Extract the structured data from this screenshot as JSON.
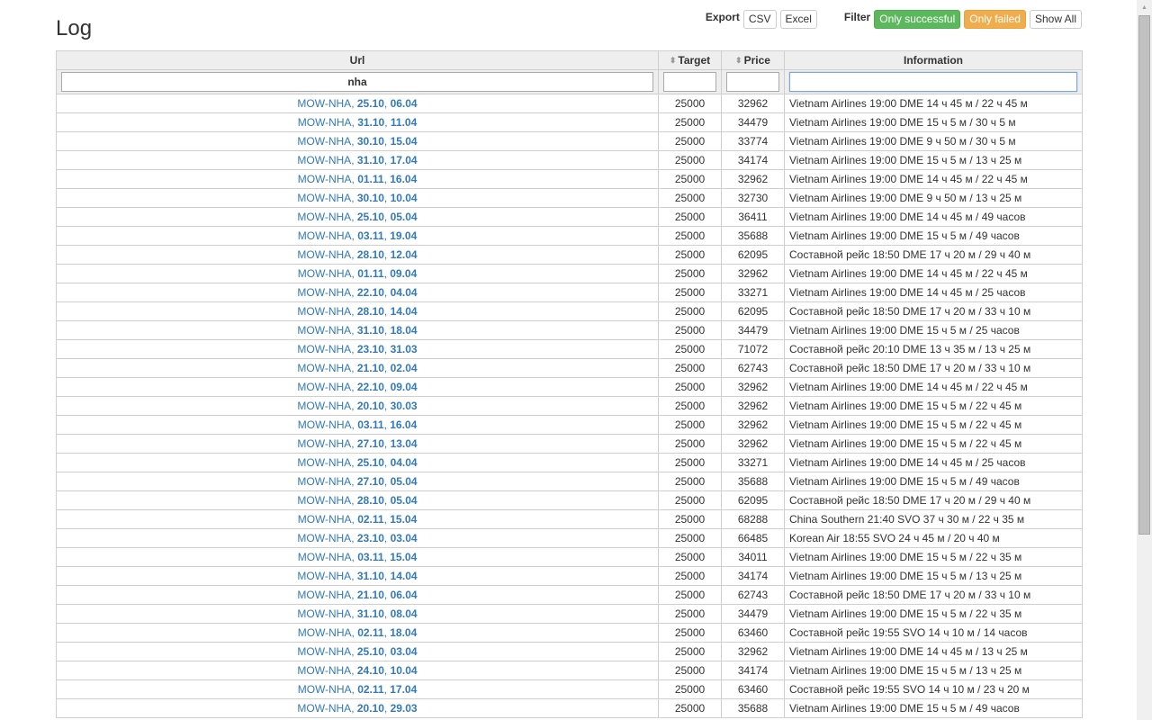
{
  "page": {
    "title": "Log"
  },
  "toolbar": {
    "export_label": "Export",
    "csv_label": "CSV",
    "excel_label": "Excel",
    "filter_label": "Filter",
    "only_successful_label": "Only successful",
    "only_failed_label": "Only failed",
    "show_all_label": "Show All",
    "colors": {
      "success": "#5cb85c",
      "warning": "#f0ad4e"
    }
  },
  "table": {
    "columns": [
      {
        "label": "Url",
        "sortable": false,
        "filter_value": "nha"
      },
      {
        "label": "Target",
        "sortable": true,
        "filter_value": ""
      },
      {
        "label": "Price",
        "sortable": true,
        "filter_value": ""
      },
      {
        "label": "Information",
        "sortable": false,
        "filter_value": ""
      }
    ],
    "sort_icon": "sort-both-icon",
    "link_color": "#337ab7",
    "rows": [
      {
        "route": "MOW-NHA",
        "d1": "25.10",
        "d2": "06.04",
        "target": "25000",
        "price": "32962",
        "info": "Vietnam Airlines 19:00 DME 14 ч 45 м / 22 ч 45 м"
      },
      {
        "route": "MOW-NHA",
        "d1": "31.10",
        "d2": "11.04",
        "target": "25000",
        "price": "34479",
        "info": "Vietnam Airlines 19:00 DME 15 ч 5 м / 30 ч 5 м"
      },
      {
        "route": "MOW-NHA",
        "d1": "30.10",
        "d2": "15.04",
        "target": "25000",
        "price": "33774",
        "info": "Vietnam Airlines 19:00 DME 9 ч 50 м / 30 ч 5 м"
      },
      {
        "route": "MOW-NHA",
        "d1": "31.10",
        "d2": "17.04",
        "target": "25000",
        "price": "34174",
        "info": "Vietnam Airlines 19:00 DME 15 ч 5 м / 13 ч 25 м"
      },
      {
        "route": "MOW-NHA",
        "d1": "01.11",
        "d2": "16.04",
        "target": "25000",
        "price": "32962",
        "info": "Vietnam Airlines 19:00 DME 14 ч 45 м / 22 ч 45 м"
      },
      {
        "route": "MOW-NHA",
        "d1": "30.10",
        "d2": "10.04",
        "target": "25000",
        "price": "32730",
        "info": "Vietnam Airlines 19:00 DME 9 ч 50 м / 13 ч 25 м"
      },
      {
        "route": "MOW-NHA",
        "d1": "25.10",
        "d2": "05.04",
        "target": "25000",
        "price": "36411",
        "info": "Vietnam Airlines 19:00 DME 14 ч 45 м / 49 часов"
      },
      {
        "route": "MOW-NHA",
        "d1": "03.11",
        "d2": "19.04",
        "target": "25000",
        "price": "35688",
        "info": "Vietnam Airlines 19:00 DME 15 ч 5 м / 49 часов"
      },
      {
        "route": "MOW-NHA",
        "d1": "28.10",
        "d2": "12.04",
        "target": "25000",
        "price": "62095",
        "info": "Составной рейс 18:50 DME 17 ч 20 м / 29 ч 40 м"
      },
      {
        "route": "MOW-NHA",
        "d1": "01.11",
        "d2": "09.04",
        "target": "25000",
        "price": "32962",
        "info": "Vietnam Airlines 19:00 DME 14 ч 45 м / 22 ч 45 м"
      },
      {
        "route": "MOW-NHA",
        "d1": "22.10",
        "d2": "04.04",
        "target": "25000",
        "price": "33271",
        "info": "Vietnam Airlines 19:00 DME 14 ч 45 м / 25 часов"
      },
      {
        "route": "MOW-NHA",
        "d1": "28.10",
        "d2": "14.04",
        "target": "25000",
        "price": "62095",
        "info": "Составной рейс 18:50 DME 17 ч 20 м / 33 ч 10 м"
      },
      {
        "route": "MOW-NHA",
        "d1": "31.10",
        "d2": "18.04",
        "target": "25000",
        "price": "34479",
        "info": "Vietnam Airlines 19:00 DME 15 ч 5 м / 25 часов"
      },
      {
        "route": "MOW-NHA",
        "d1": "23.10",
        "d2": "31.03",
        "target": "25000",
        "price": "71072",
        "info": "Составной рейс 20:10 DME 13 ч 35 м / 13 ч 25 м"
      },
      {
        "route": "MOW-NHA",
        "d1": "21.10",
        "d2": "02.04",
        "target": "25000",
        "price": "62743",
        "info": "Составной рейс 18:50 DME 17 ч 20 м / 33 ч 10 м"
      },
      {
        "route": "MOW-NHA",
        "d1": "22.10",
        "d2": "09.04",
        "target": "25000",
        "price": "32962",
        "info": "Vietnam Airlines 19:00 DME 14 ч 45 м / 22 ч 45 м"
      },
      {
        "route": "MOW-NHA",
        "d1": "20.10",
        "d2": "30.03",
        "target": "25000",
        "price": "32962",
        "info": "Vietnam Airlines 19:00 DME 15 ч 5 м / 22 ч 45 м"
      },
      {
        "route": "MOW-NHA",
        "d1": "03.11",
        "d2": "16.04",
        "target": "25000",
        "price": "32962",
        "info": "Vietnam Airlines 19:00 DME 15 ч 5 м / 22 ч 45 м"
      },
      {
        "route": "MOW-NHA",
        "d1": "27.10",
        "d2": "13.04",
        "target": "25000",
        "price": "32962",
        "info": "Vietnam Airlines 19:00 DME 15 ч 5 м / 22 ч 45 м"
      },
      {
        "route": "MOW-NHA",
        "d1": "25.10",
        "d2": "04.04",
        "target": "25000",
        "price": "33271",
        "info": "Vietnam Airlines 19:00 DME 14 ч 45 м / 25 часов"
      },
      {
        "route": "MOW-NHA",
        "d1": "27.10",
        "d2": "05.04",
        "target": "25000",
        "price": "35688",
        "info": "Vietnam Airlines 19:00 DME 15 ч 5 м / 49 часов"
      },
      {
        "route": "MOW-NHA",
        "d1": "28.10",
        "d2": "05.04",
        "target": "25000",
        "price": "62095",
        "info": "Составной рейс 18:50 DME 17 ч 20 м / 29 ч 40 м"
      },
      {
        "route": "MOW-NHA",
        "d1": "02.11",
        "d2": "15.04",
        "target": "25000",
        "price": "68288",
        "info": "China Southern 21:40 SVO 37 ч 30 м / 22 ч 35 м"
      },
      {
        "route": "MOW-NHA",
        "d1": "23.10",
        "d2": "03.04",
        "target": "25000",
        "price": "66485",
        "info": "Korean Air 18:55 SVO 24 ч 45 м / 20 ч 40 м"
      },
      {
        "route": "MOW-NHA",
        "d1": "03.11",
        "d2": "15.04",
        "target": "25000",
        "price": "34011",
        "info": "Vietnam Airlines 19:00 DME 15 ч 5 м / 22 ч 35 м"
      },
      {
        "route": "MOW-NHA",
        "d1": "31.10",
        "d2": "14.04",
        "target": "25000",
        "price": "34174",
        "info": "Vietnam Airlines 19:00 DME 15 ч 5 м / 13 ч 25 м"
      },
      {
        "route": "MOW-NHA",
        "d1": "21.10",
        "d2": "06.04",
        "target": "25000",
        "price": "62743",
        "info": "Составной рейс 18:50 DME 17 ч 20 м / 33 ч 10 м"
      },
      {
        "route": "MOW-NHA",
        "d1": "31.10",
        "d2": "08.04",
        "target": "25000",
        "price": "34479",
        "info": "Vietnam Airlines 19:00 DME 15 ч 5 м / 22 ч 35 м"
      },
      {
        "route": "MOW-NHA",
        "d1": "02.11",
        "d2": "18.04",
        "target": "25000",
        "price": "63460",
        "info": "Составной рейс 19:55 SVO 14 ч 10 м / 14 часов"
      },
      {
        "route": "MOW-NHA",
        "d1": "25.10",
        "d2": "03.04",
        "target": "25000",
        "price": "32962",
        "info": "Vietnam Airlines 19:00 DME 14 ч 45 м / 13 ч 25 м"
      },
      {
        "route": "MOW-NHA",
        "d1": "24.10",
        "d2": "10.04",
        "target": "25000",
        "price": "34174",
        "info": "Vietnam Airlines 19:00 DME 15 ч 5 м / 13 ч 25 м"
      },
      {
        "route": "MOW-NHA",
        "d1": "02.11",
        "d2": "17.04",
        "target": "25000",
        "price": "63460",
        "info": "Составной рейс 19:55 SVO 14 ч 10 м / 23 ч 20 м"
      },
      {
        "route": "MOW-NHA",
        "d1": "20.10",
        "d2": "29.03",
        "target": "25000",
        "price": "35688",
        "info": "Vietnam Airlines 19:00 DME 15 ч 5 м / 49 часов"
      }
    ]
  },
  "scrollbar": {
    "up_arrow_icon": "scroll-up-arrow-icon"
  }
}
